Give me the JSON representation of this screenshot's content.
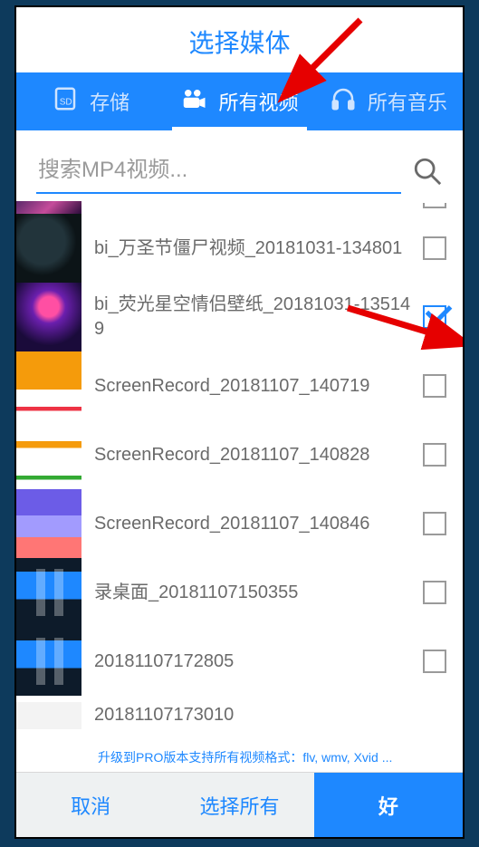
{
  "title": "选择媒体",
  "tabs": {
    "storage": "存储",
    "videos": "所有视频",
    "music": "所有音乐",
    "active": "videos"
  },
  "search": {
    "placeholder": "搜索MP4视频..."
  },
  "items": [
    {
      "name": "",
      "checked": false
    },
    {
      "name": "bi_万圣节僵尸视频_20181031-134801",
      "checked": false
    },
    {
      "name": "bi_荧光星空情侣壁纸_20181031-135149",
      "checked": true
    },
    {
      "name": "ScreenRecord_20181107_140719",
      "checked": false
    },
    {
      "name": "ScreenRecord_20181107_140828",
      "checked": false
    },
    {
      "name": "ScreenRecord_20181107_140846",
      "checked": false
    },
    {
      "name": "录桌面_20181107150355",
      "checked": false
    },
    {
      "name": "20181107172805",
      "checked": false
    },
    {
      "name": "20181107173010",
      "checked": false
    }
  ],
  "pro_note": "升级到PRO版本支持所有视频格式：flv, wmv, Xvid ...",
  "footer": {
    "cancel": "取消",
    "select_all": "选择所有",
    "ok": "好"
  }
}
